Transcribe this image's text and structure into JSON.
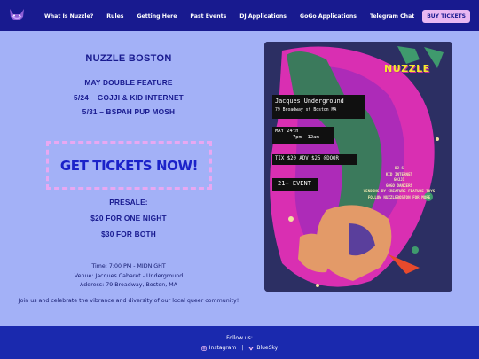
{
  "nav": {
    "items": [
      "What Is Nuzzle?",
      "Rules",
      "Getting Here",
      "Past Events",
      "DJ Applications",
      "GoGo Applications",
      "Telegram Chat"
    ],
    "buy_button": "BUY TICKETS"
  },
  "event": {
    "title": "NUZZLE BOSTON",
    "subtitle": "MAY DOUBLE FEATURE",
    "night1": "5/24 – GOJJI & KID INTERNET",
    "night2": "5/31 – BSPAH PUP MOSH"
  },
  "cta": {
    "label": "GET TICKETS NOW!"
  },
  "presale": {
    "heading": "PRESALE:",
    "one_night": "$20 FOR ONE NIGHT",
    "both": "$30 FOR BOTH"
  },
  "details": {
    "time": "Time: 7:00 PM - MIDNIGHT",
    "venue": "Venue: Jacques Cabaret - Underground",
    "address": "Address: 79 Broadway, Boston, MA"
  },
  "tagline": "Join us and celebrate the vibrance and diversity of our local queer community!",
  "poster": {
    "logo": "NUZZLE",
    "venue": "Jacques Underground",
    "address": "79 Broadway st Boston MA",
    "date": "MAY 24th",
    "time": "7pm -12am",
    "tix": "TIX $20 ADV $25 @DOOR",
    "age": "21+ EVENT",
    "lineup": [
      "DJ S",
      "KID INTERNET",
      "GOJJI",
      "GOGO DANCERS",
      "VENDING BY CREATURE FEATURE TOYS",
      "FOLLOW   NUZZLEBOSTON FOR MORE"
    ]
  },
  "footer": {
    "follow": "Follow us:",
    "instagram": "Instagram",
    "separator": "|",
    "bluesky": "BlueSky"
  },
  "colors": {
    "background": "#a3b1f7",
    "nav_bg": "#181a8f",
    "footer_bg": "#1a29ae",
    "accent_pink": "#e8b7f2",
    "cta_text": "#1b22c9"
  }
}
